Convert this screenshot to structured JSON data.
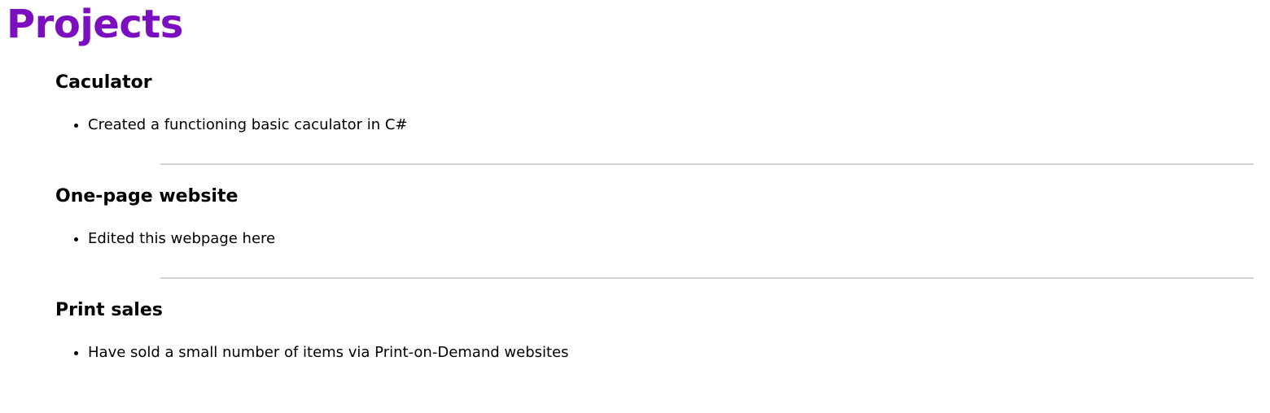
{
  "page": {
    "title": "Projects",
    "title_color": "#7b0fbf"
  },
  "projects": [
    {
      "title": "Caculator",
      "bullets": [
        "Created a functioning basic caculator in C#"
      ]
    },
    {
      "title": "One-page website",
      "bullets": [
        "Edited this webpage here"
      ]
    },
    {
      "title": "Print sales",
      "bullets": [
        "Have sold a small number of items via Print-on-Demand websites"
      ]
    }
  ]
}
